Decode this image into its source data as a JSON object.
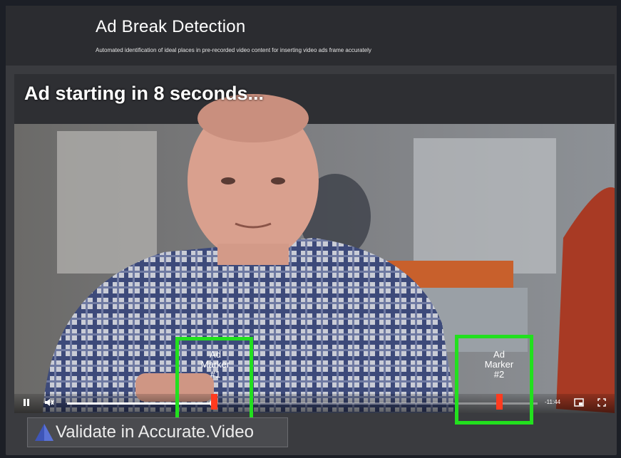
{
  "header": {
    "title": "Ad Break Detection",
    "subtitle": "Automated identification of ideal places in pre-recorded video content for inserting video ads frame accurately"
  },
  "video": {
    "overlay_text": "Ad starting in 8 seconds...",
    "time_remaining": "-11:44",
    "progress_fraction": 0.31,
    "markers": [
      {
        "label_line1": "Ad",
        "label_line2": "Marker",
        "label_line3": "#1"
      },
      {
        "label_line1": "Ad",
        "label_line2": "Marker",
        "label_line3": "#2"
      }
    ]
  },
  "icons": {
    "play_pause": "pause-icon",
    "volume": "mute-icon",
    "pip": "picture-in-picture-icon",
    "fullscreen": "fullscreen-icon"
  },
  "colors": {
    "highlight": "#22e01e",
    "marker": "#ff3b1f"
  },
  "validate_button": {
    "label": "Validate in Accurate.Video"
  }
}
